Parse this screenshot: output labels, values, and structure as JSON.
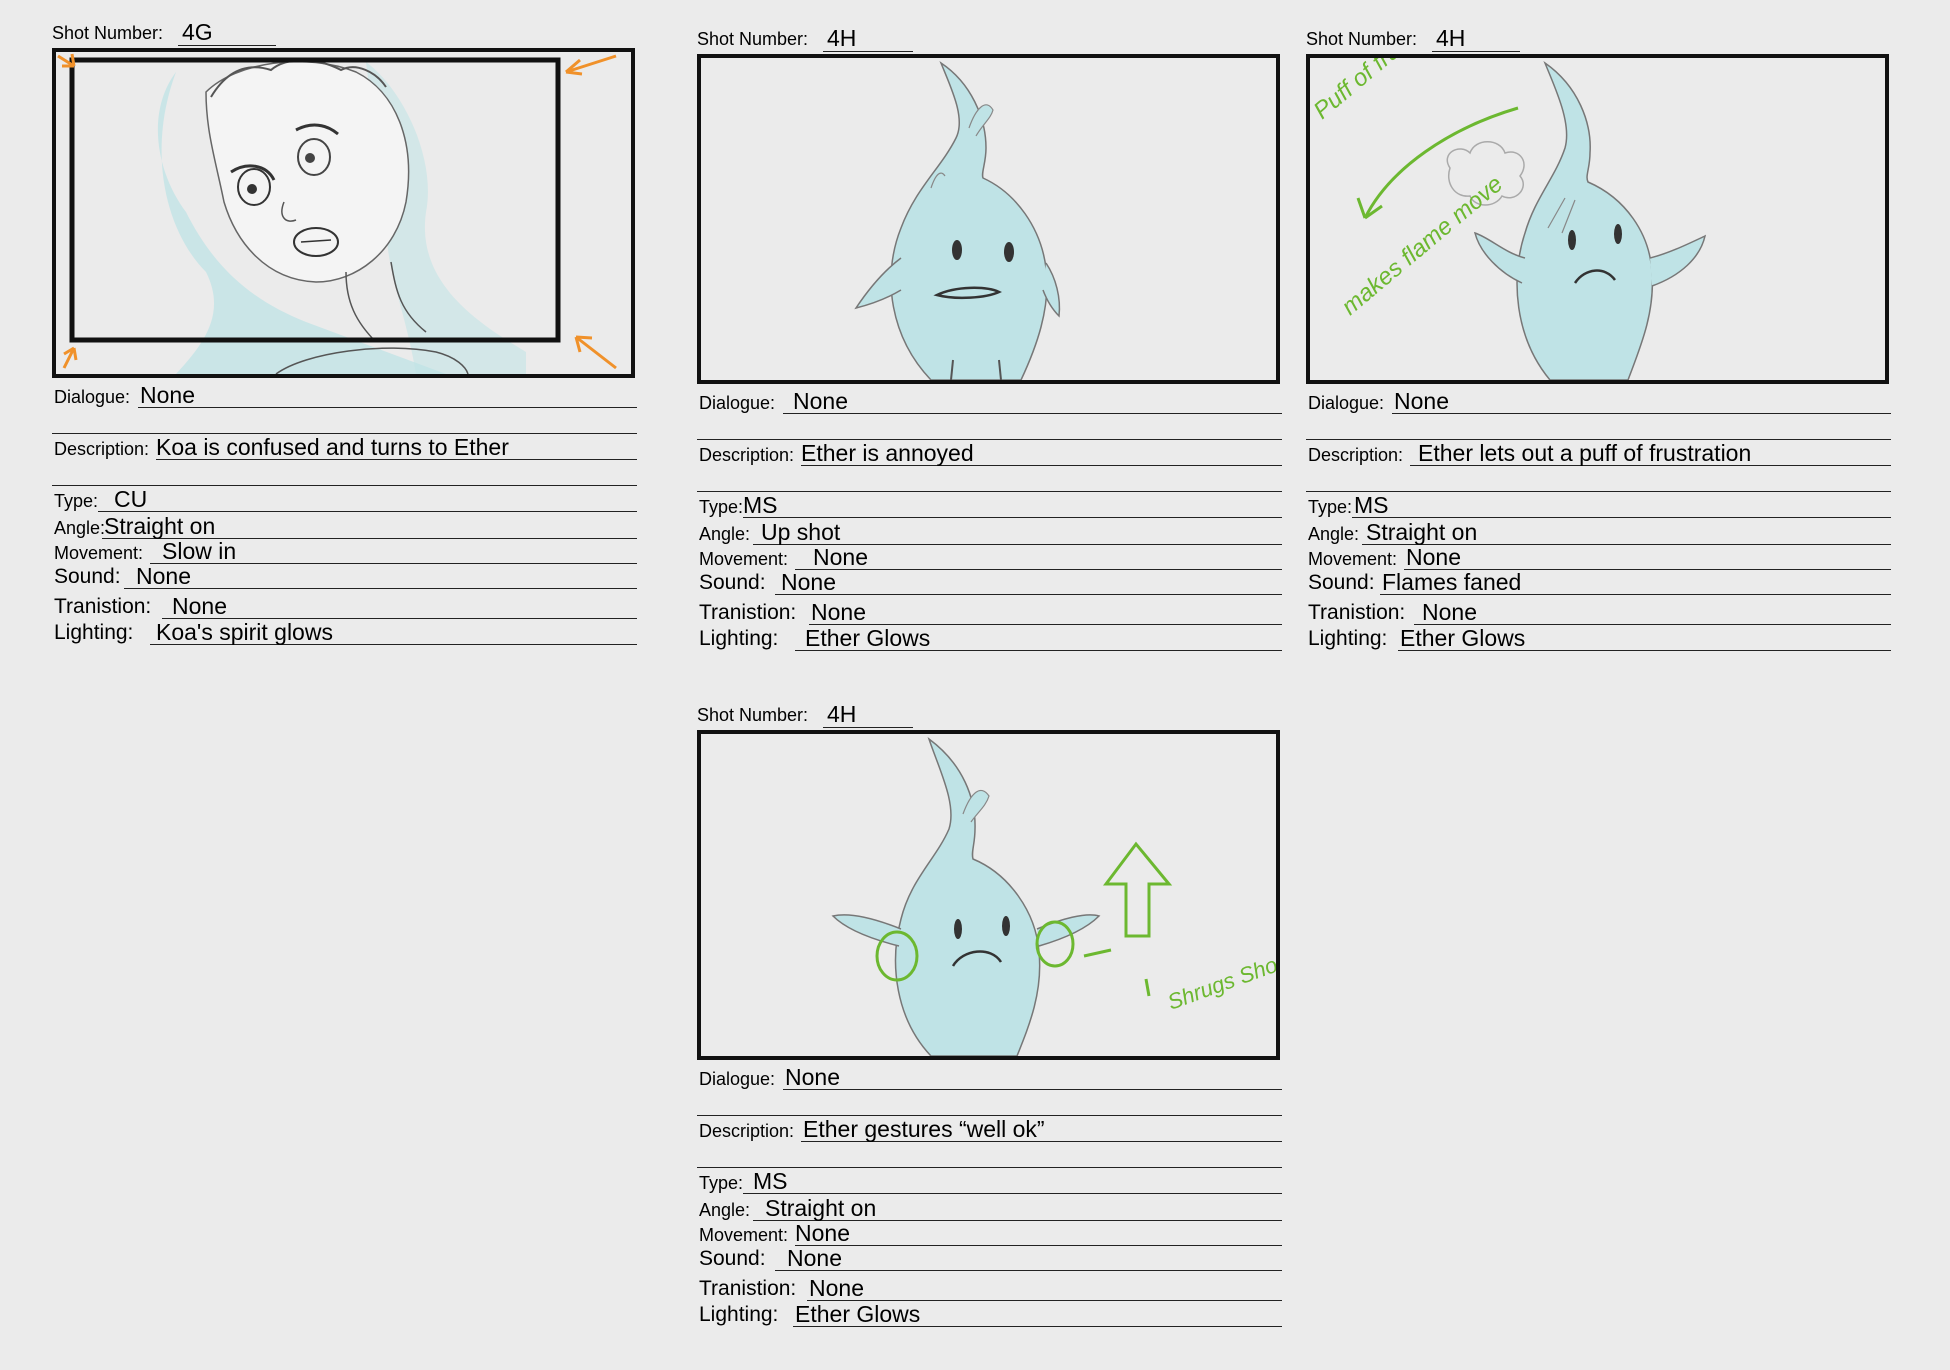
{
  "panels": [
    {
      "shot_label": "Shot Number:",
      "shot_number": "4G",
      "dialogue_label": "Dialogue:",
      "dialogue": "None",
      "description_label": "Description:",
      "description": "Koa is confused and turns to Ether",
      "type_label": "Type:",
      "type": "CU",
      "angle_label": "Angle:",
      "angle": "Straight on",
      "movement_label": "Movement:",
      "movement": "Slow in",
      "sound_label": "Sound:",
      "sound": "None",
      "transition_label": "Tranistion:",
      "transition": "None",
      "lighting_label": "Lighting:",
      "lighting": "Koa's spirit glows"
    },
    {
      "shot_label": "Shot Number:",
      "shot_number": "4H",
      "dialogue_label": "Dialogue:",
      "dialogue": "None",
      "description_label": "Description:",
      "description": "Ether is annoyed",
      "type_label": "Type:",
      "type": "MS",
      "angle_label": "Angle:",
      "angle": "Up shot",
      "movement_label": "Movement:",
      "movement": "None",
      "sound_label": "Sound:",
      "sound": "None",
      "transition_label": "Tranistion:",
      "transition": "None",
      "lighting_label": "Lighting:",
      "lighting": "Ether Glows"
    },
    {
      "shot_label": "Shot Number:",
      "shot_number": "4H",
      "annotation_1": "Puff of frustration",
      "annotation_2": "makes flame move",
      "dialogue_label": "Dialogue:",
      "dialogue": "None",
      "description_label": "Description:",
      "description": "Ether lets out a puff of frustration",
      "type_label": "Type:",
      "type": "MS",
      "angle_label": "Angle:",
      "angle": "Straight on",
      "movement_label": "Movement:",
      "movement": "None",
      "sound_label": "Sound:",
      "sound": "Flames faned",
      "transition_label": "Tranistion:",
      "transition": "None",
      "lighting_label": "Lighting:",
      "lighting": "Ether Glows"
    },
    {
      "shot_label": "Shot Number:",
      "shot_number": "4H",
      "annotation_1": "Shrugs Shoulders",
      "dialogue_label": "Dialogue:",
      "dialogue": "None",
      "description_label": "Description:",
      "description": "Ether gestures “well ok”",
      "type_label": "Type:",
      "type": "MS",
      "angle_label": "Angle:",
      "angle": "Straight on",
      "movement_label": "Movement:",
      "movement": "None",
      "sound_label": "Sound:",
      "sound": "None",
      "transition_label": "Tranistion:",
      "transition": "None",
      "lighting_label": "Lighting:",
      "lighting": "Ether Glows"
    }
  ],
  "colors": {
    "spirit": "#bfe3e6",
    "annotation_green": "#6cb830",
    "camera_arrow_orange": "#f0912a",
    "frame": "#111111"
  }
}
